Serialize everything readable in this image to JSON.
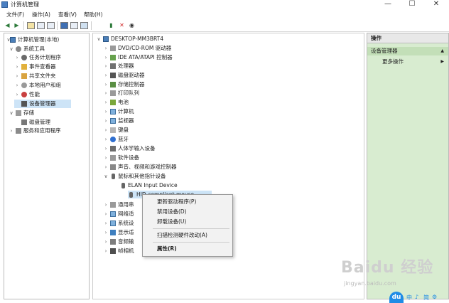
{
  "window": {
    "title": "计算机管理",
    "minimize": "—",
    "maximize": "☐",
    "close": "✕"
  },
  "menu": [
    "文件(F)",
    "操作(A)",
    "查看(V)",
    "帮助(H)"
  ],
  "left_tree": {
    "root": "计算机管理(本地)",
    "system_tools": "系统工具",
    "task_scheduler": "任务计划程序",
    "event_viewer": "事件查看器",
    "shared_folders": "共享文件夹",
    "local_users": "本地用户和组",
    "performance": "性能",
    "device_manager": "设备管理器",
    "storage": "存储",
    "disk_management": "磁盘管理",
    "services": "服务和应用程序"
  },
  "device_tree": {
    "computer": "DESKTOP-MM3BRT4",
    "categories": [
      "DVD/CD-ROM 驱动器",
      "IDE ATA/ATAPI 控制器",
      "处理器",
      "磁盘驱动器",
      "存储控制器",
      "打印队列",
      "电池",
      "计算机",
      "监视器",
      "键盘",
      "蓝牙",
      "人体学输入设备",
      "软件设备",
      "声音、视频和游戏控制器",
      "鼠标和其他指针设备"
    ],
    "mouse_children": [
      "ELAN Input Device",
      "HID-compliant mouse"
    ],
    "after": [
      "通用串",
      "网络适",
      "系统设",
      "显示适",
      "音频输",
      "帧相机"
    ]
  },
  "actions": {
    "header": "操作",
    "section": "设备管理器",
    "more": "更多操作",
    "more_arrow": "▶",
    "section_arrow": "▲"
  },
  "context_menu": {
    "update_driver": "更新驱动程序(P)",
    "disable": "禁用设备(D)",
    "uninstall": "卸载设备(U)",
    "scan": "扫描检测硬件改动(A)",
    "properties": "属性(R)"
  },
  "watermark": {
    "brand": "Baidu 经验",
    "url": "jingyan.baidu.com"
  },
  "footer": {
    "du": "du",
    "a": "中",
    "b": "♪",
    "c": "简",
    "d": "⚙"
  }
}
